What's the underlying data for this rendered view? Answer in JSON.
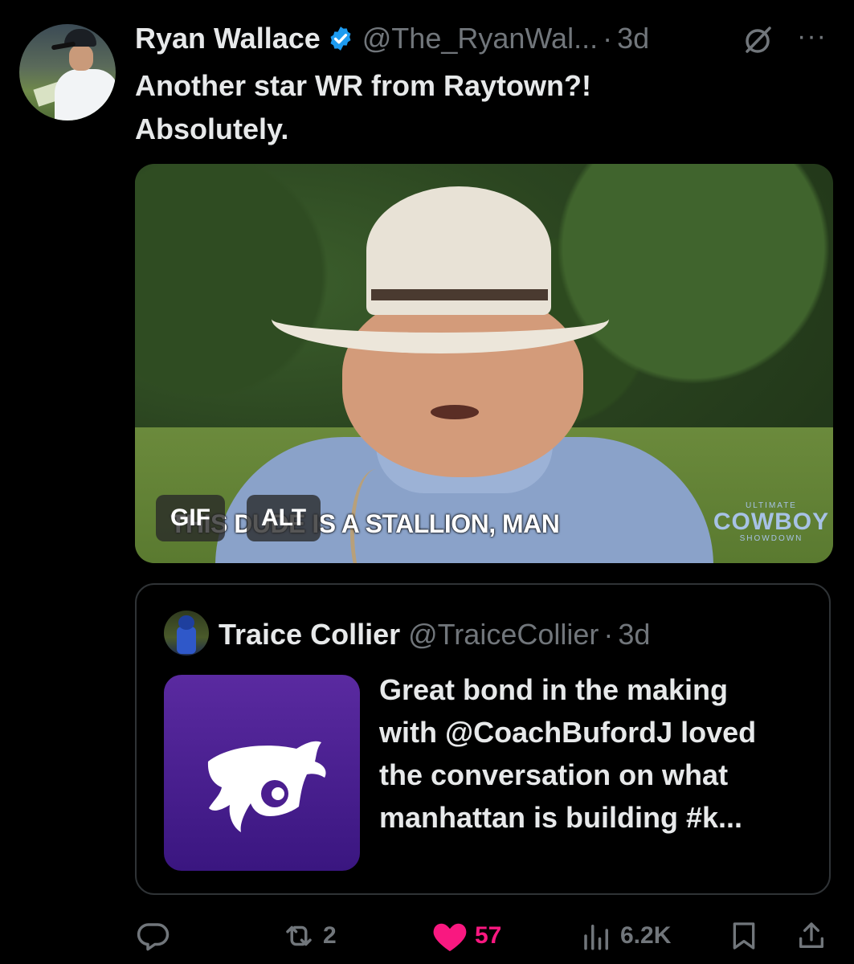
{
  "tweet": {
    "author_name": "Ryan Wallace",
    "handle": "@The_RyanWal...",
    "separator": "·",
    "time": "3d",
    "more_label": "···",
    "text_lines": [
      "Another star WR from Raytown?!",
      "Absolutely."
    ],
    "verified": true,
    "accent_color": "#1d9bf0"
  },
  "media": {
    "caption": "THIS DUDE IS A STALLION, MAN",
    "watermark_top": "ULTIMATE",
    "watermark_main": "COWBOY",
    "watermark_bottom": "SHOWDOWN",
    "gif_badge": "GIF",
    "alt_badge": "ALT"
  },
  "quoted_tweet": {
    "author_name": "Traice Collier",
    "handle": "@TraiceCollier",
    "separator": "·",
    "time": "3d",
    "text_lines": [
      "Great bond in the making",
      "with @CoachBufordJ loved",
      "the conversation on what",
      "manhattan is building #k..."
    ],
    "thumb_color": "#4b1f8f"
  },
  "actions": {
    "reply_icon": "reply-icon",
    "retweet_count": "2",
    "like_count": "57",
    "like_color": "#f91880",
    "views_count": "6.2K",
    "bookmark_icon": "bookmark-icon",
    "share_icon": "share-icon"
  }
}
